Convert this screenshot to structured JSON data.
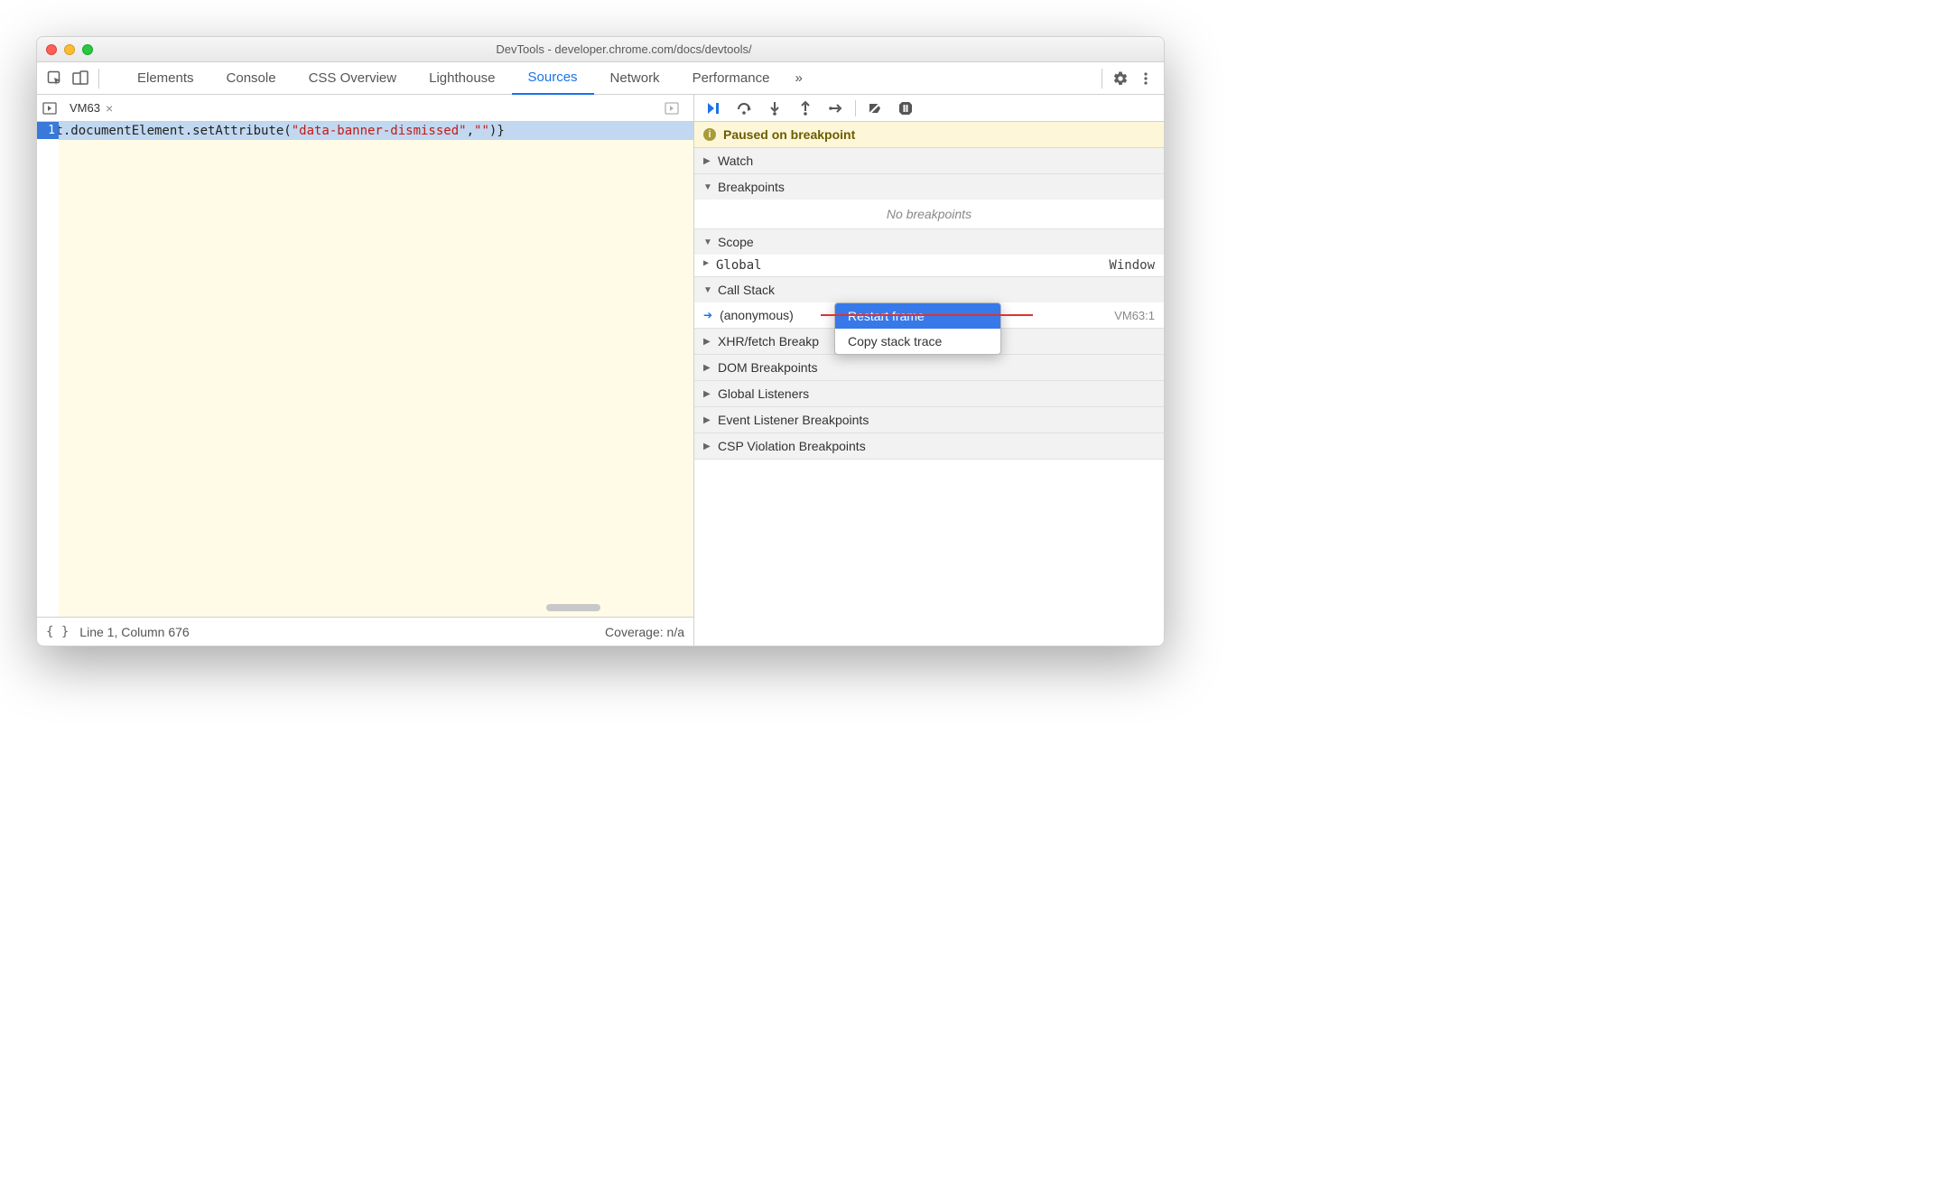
{
  "titlebar": {
    "title": "DevTools - developer.chrome.com/docs/devtools/"
  },
  "tabs": {
    "items": [
      "Elements",
      "Console",
      "CSS Overview",
      "Lighthouse",
      "Sources",
      "Network",
      "Performance"
    ],
    "active_index": 4,
    "overflow_glyph": "»"
  },
  "filetab": {
    "name": "VM63"
  },
  "code": {
    "line_number": "1",
    "prefix": "nt.documentElement.setAttribute(",
    "string_literal": "\"data-banner-dismissed\"",
    "mid": ",",
    "empty_str": "\"\"",
    "suffix": ")}"
  },
  "statusbar": {
    "pretty": "{ }",
    "position": "Line 1, Column 676",
    "coverage": "Coverage: n/a"
  },
  "debugger": {
    "banner": "Paused on breakpoint",
    "sections": {
      "watch": "Watch",
      "breakpoints": "Breakpoints",
      "no_breakpoints": "No breakpoints",
      "scope": "Scope",
      "scope_global": "Global",
      "scope_global_val": "Window",
      "call_stack": "Call Stack",
      "cs_item": "(anonymous)",
      "cs_loc": "VM63:1",
      "xhr": "XHR/fetch Breakp",
      "dom": "DOM Breakpoints",
      "global_listeners": "Global Listeners",
      "event_listener": "Event Listener Breakpoints",
      "csp": "CSP Violation Breakpoints"
    }
  },
  "context_menu": {
    "items": [
      "Restart frame",
      "Copy stack trace"
    ]
  }
}
